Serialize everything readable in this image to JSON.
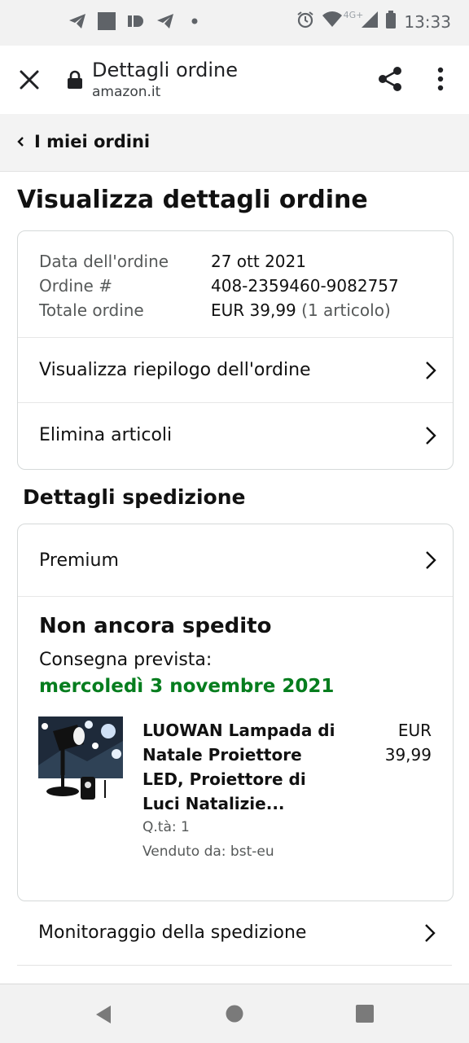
{
  "status_bar": {
    "time": "13:33",
    "network_label": "4G+",
    "icons": [
      "telegram-icon",
      "app-square-icon",
      "media-icon",
      "telegram-icon",
      "dot-icon",
      "alarm-icon",
      "wifi-icon",
      "signal-icon",
      "battery-icon"
    ]
  },
  "browser": {
    "title": "Dettagli ordine",
    "domain": "amazon.it",
    "icons": [
      "close-icon",
      "lock-icon",
      "share-icon",
      "more-vert-icon"
    ]
  },
  "breadcrumb": {
    "label": "I miei ordini",
    "icon": "chevron-left-icon"
  },
  "page": {
    "heading": "Visualizza dettagli ordine"
  },
  "order_summary": {
    "rows": [
      {
        "label": "Data dell'ordine",
        "value": "27 ott 2021",
        "note": ""
      },
      {
        "label": "Ordine #",
        "value": "408-2359460-9082757",
        "note": ""
      },
      {
        "label": "Totale ordine",
        "value": "EUR 39,99",
        "note": "(1 articolo)"
      }
    ],
    "links": [
      {
        "label": "Visualizza riepilogo dell'ordine"
      },
      {
        "label": "Elimina articoli"
      }
    ]
  },
  "shipping": {
    "heading": "Dettagli spedizione",
    "method": "Premium",
    "status": "Non ancora spedito",
    "delivery_label": "Consegna prevista:",
    "delivery_date": "mercoledì 3 novembre 2021",
    "item": {
      "title_lines": [
        "LUOWAN Lampada di",
        "Natale Proiettore",
        "LED, Proiettore di",
        "Luci Natalizie..."
      ],
      "price_currency": "EUR",
      "price_value": "39,99",
      "quantity": "Q.tà: 1",
      "seller": "Venduto da: bst-eu"
    },
    "tracking_label": "Monitoraggio della spedizione"
  },
  "nav": {
    "icons": [
      "nav-back-icon",
      "nav-home-icon",
      "nav-recents-icon"
    ]
  },
  "colors": {
    "delivery_green": "#067d1e",
    "text": "#111111",
    "muted": "#565959"
  }
}
